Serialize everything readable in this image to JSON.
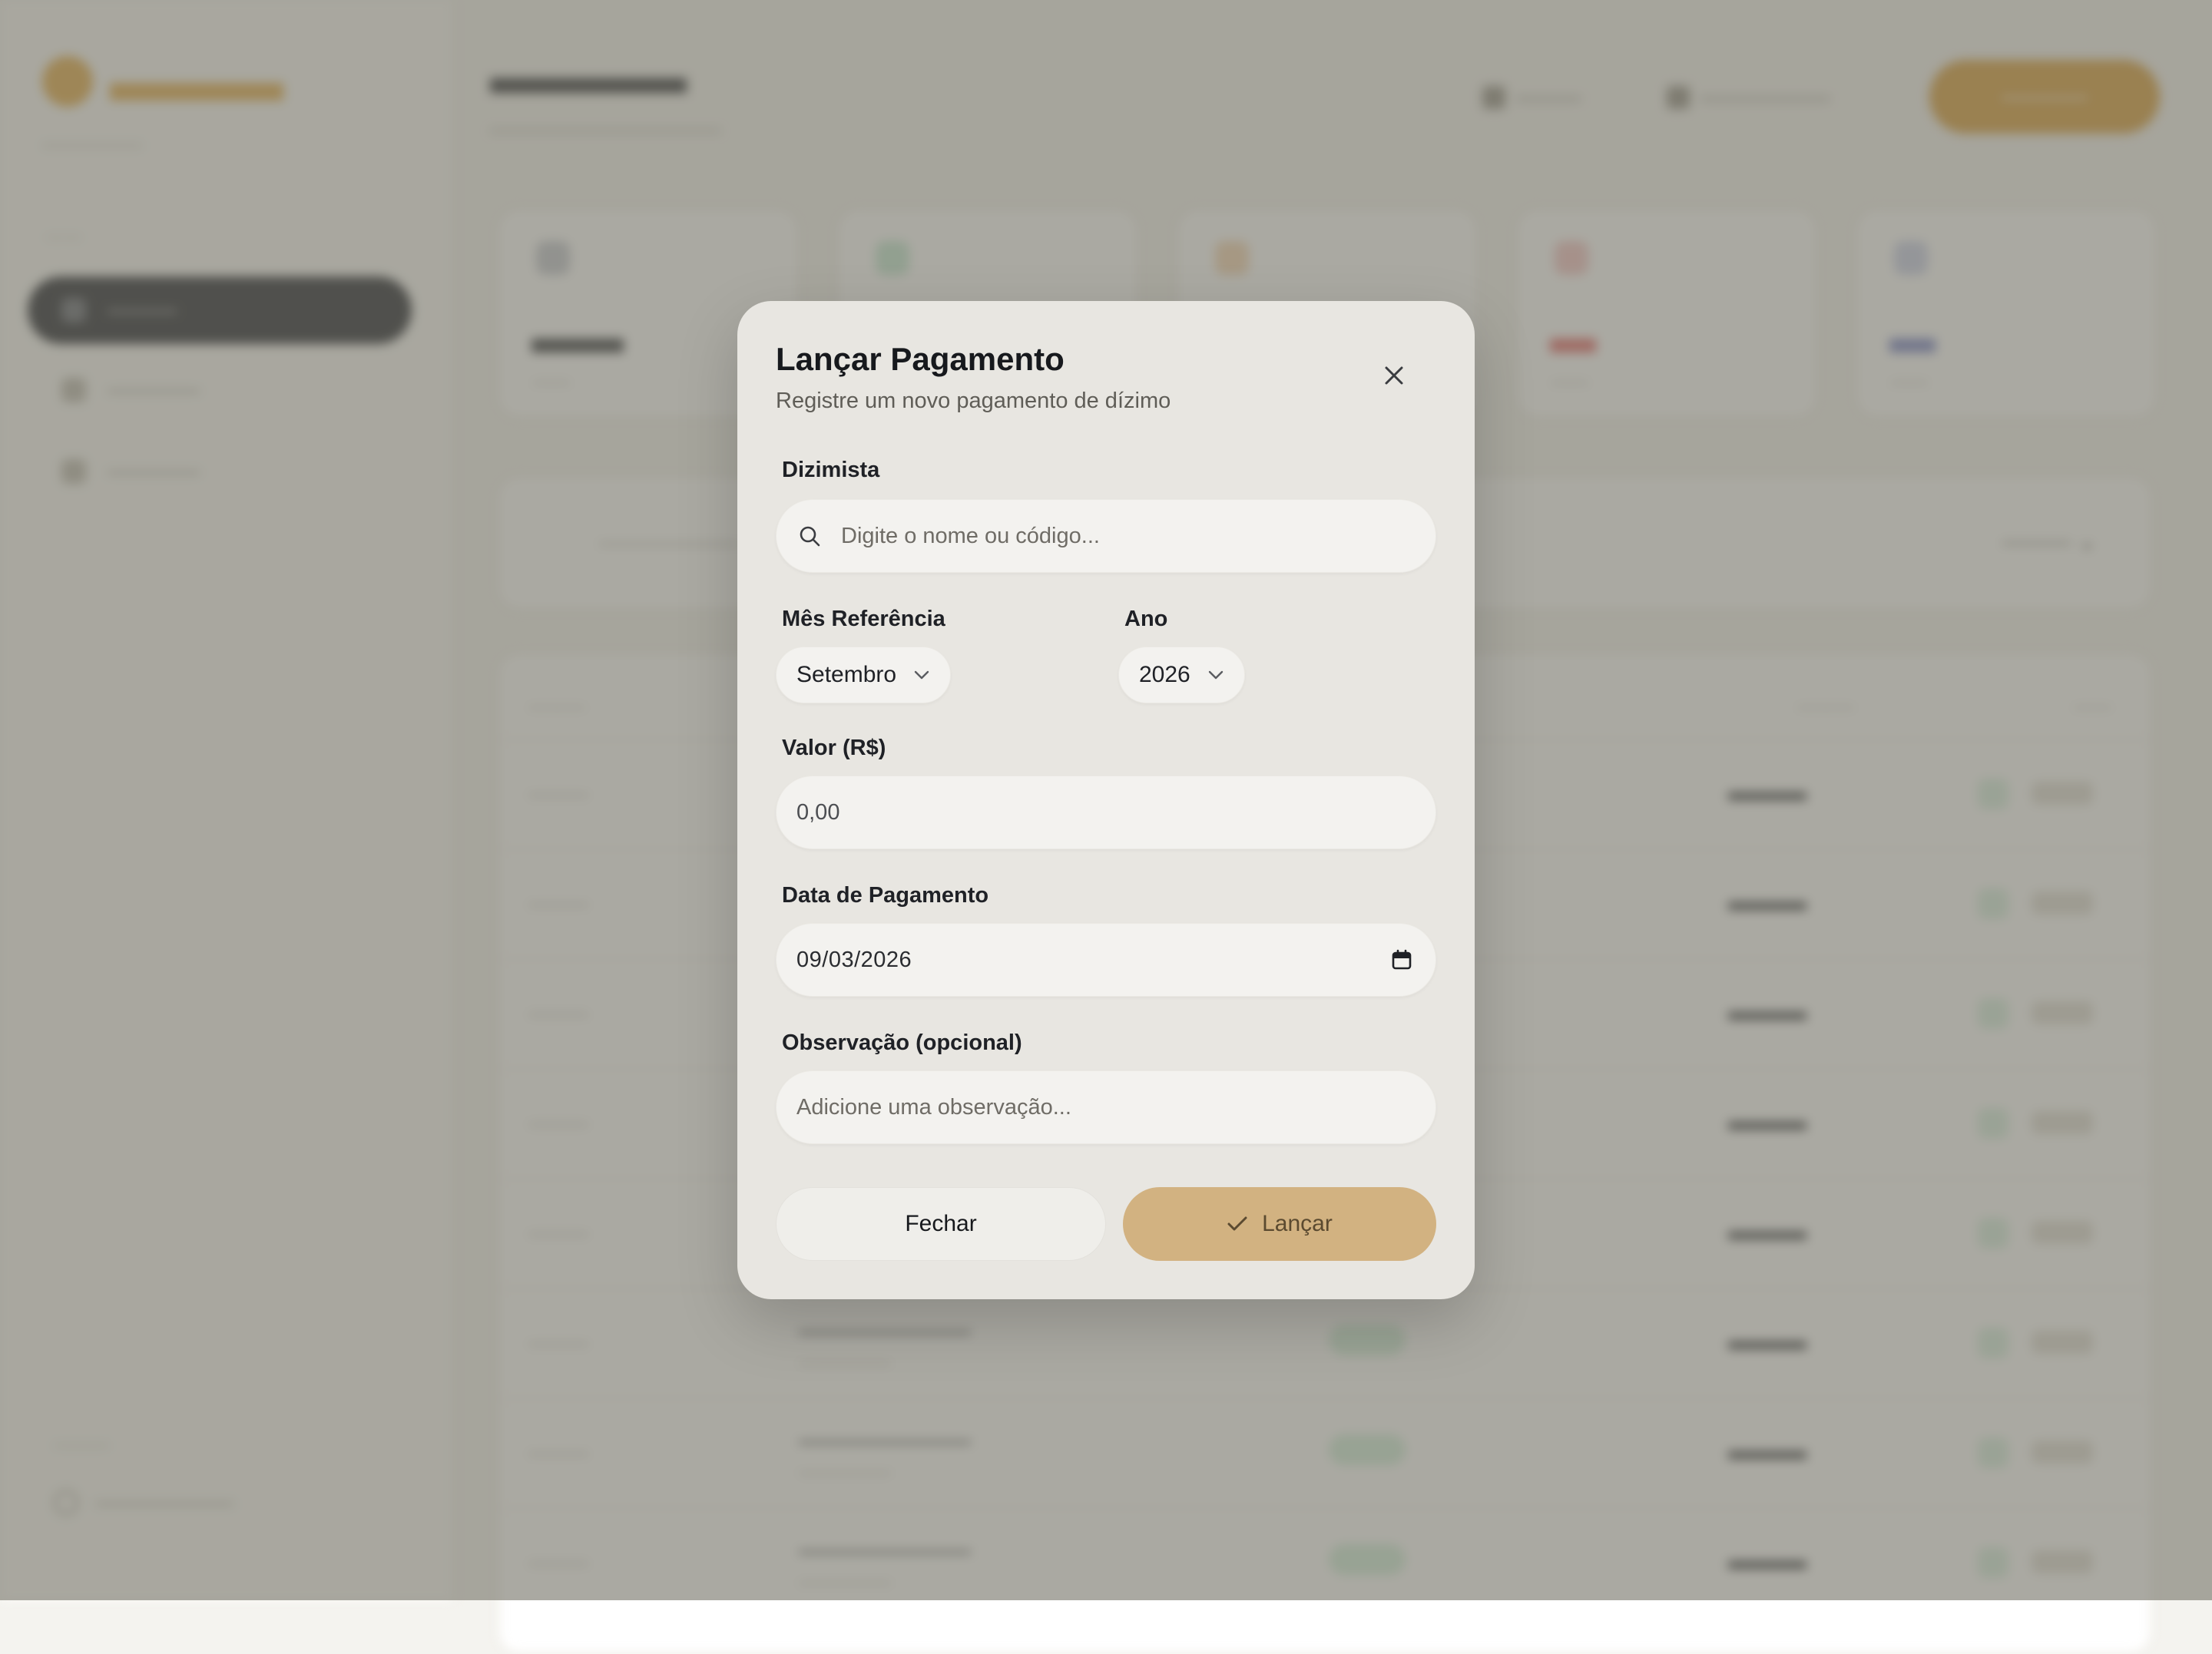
{
  "modal": {
    "title": "Lançar Pagamento",
    "subtitle": "Registre um novo pagamento de dízimo",
    "close_icon": "close-icon",
    "fields": {
      "dizimista": {
        "label": "Dizimista",
        "placeholder": "Digite o nome ou código...",
        "value": "",
        "icon": "search-icon"
      },
      "mes": {
        "label": "Mês Referência",
        "value": "Setembro"
      },
      "ano": {
        "label": "Ano",
        "value": "2026"
      },
      "valor": {
        "label": "Valor (R$)",
        "placeholder": "0,00",
        "value": ""
      },
      "data": {
        "label": "Data de Pagamento",
        "value": "09/03/2026",
        "icon": "calendar-icon"
      },
      "observacao": {
        "label": "Observação (opcional)",
        "placeholder": "Adicione uma observação...",
        "value": ""
      }
    },
    "buttons": {
      "close_label": "Fechar",
      "submit_label": "Lançar",
      "submit_icon": "check-icon"
    }
  },
  "colors": {
    "overlay": "#767469",
    "modal_bg": "#e8e6e1",
    "primary_button": "#d2b281",
    "brand_accent": "#d4952b"
  }
}
